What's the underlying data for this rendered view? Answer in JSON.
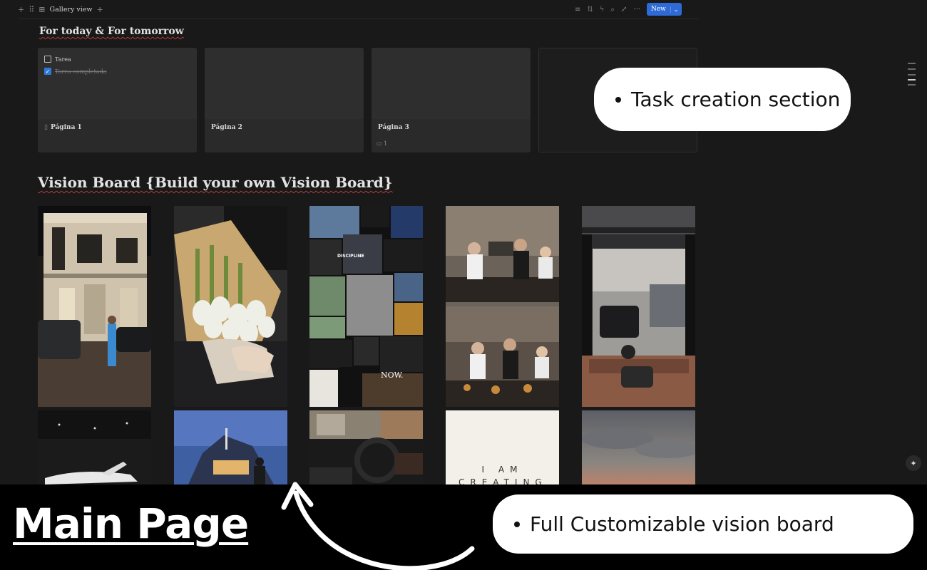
{
  "toolbar": {
    "view_label": "Gallery view",
    "new_label": "New"
  },
  "today_section": {
    "title": "For today & For tomorrow",
    "cards": [
      {
        "title": "Página 1",
        "todos": [
          {
            "text": "Tarea",
            "checked": false
          },
          {
            "text": "Tarea completada",
            "checked": true
          }
        ]
      },
      {
        "title": "Página 2"
      },
      {
        "title": "Página 3",
        "comment_count": "1"
      }
    ]
  },
  "vision_section": {
    "title": "Vision Board {Build your own Vision Board}",
    "tiles": [
      {
        "subject": "modern-house-night"
      },
      {
        "subject": "white-tulips-bouquet"
      },
      {
        "subject": "discipline-collage"
      },
      {
        "subject": "family-dinner"
      },
      {
        "subject": "garage-gym-car"
      },
      {
        "subject": "private-jet"
      },
      {
        "subject": "yacht-dusk"
      },
      {
        "subject": "car-interior-drive"
      },
      {
        "subject": "affirmation-card",
        "text": "I AM CREATING"
      },
      {
        "subject": "cloudy-sky"
      }
    ],
    "collage_labels": [
      "DISCIPLINE",
      "NOW."
    ]
  },
  "callouts": {
    "task": "Task creation section",
    "vision": "Full Customizable vision board"
  },
  "footer": {
    "heading": "Main Page"
  },
  "colors": {
    "background": "#191919",
    "accent": "#2f6bd6",
    "card": "#2a2a2a"
  }
}
